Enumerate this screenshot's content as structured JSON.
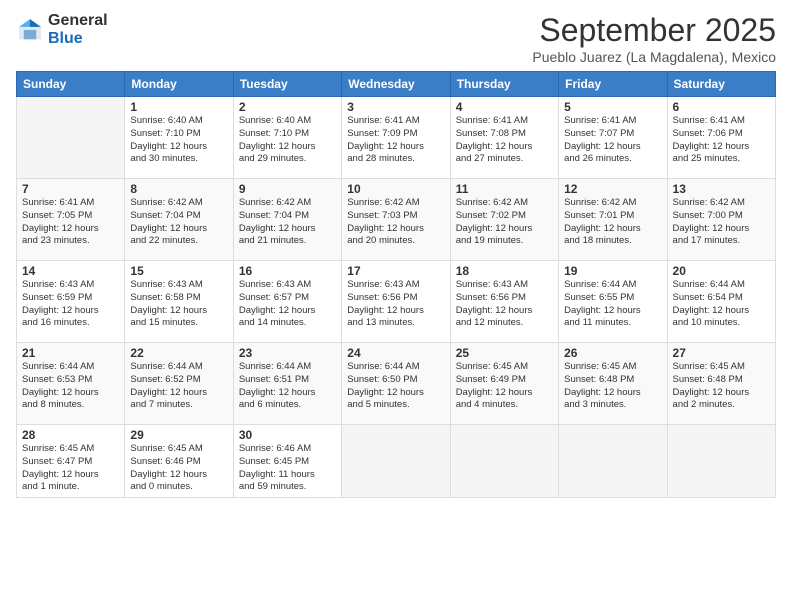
{
  "logo": {
    "general": "General",
    "blue": "Blue"
  },
  "header": {
    "month": "September 2025",
    "location": "Pueblo Juarez (La Magdalena), Mexico"
  },
  "days_of_week": [
    "Sunday",
    "Monday",
    "Tuesday",
    "Wednesday",
    "Thursday",
    "Friday",
    "Saturday"
  ],
  "weeks": [
    [
      {
        "num": "",
        "info": ""
      },
      {
        "num": "1",
        "info": "Sunrise: 6:40 AM\nSunset: 7:10 PM\nDaylight: 12 hours\nand 30 minutes."
      },
      {
        "num": "2",
        "info": "Sunrise: 6:40 AM\nSunset: 7:10 PM\nDaylight: 12 hours\nand 29 minutes."
      },
      {
        "num": "3",
        "info": "Sunrise: 6:41 AM\nSunset: 7:09 PM\nDaylight: 12 hours\nand 28 minutes."
      },
      {
        "num": "4",
        "info": "Sunrise: 6:41 AM\nSunset: 7:08 PM\nDaylight: 12 hours\nand 27 minutes."
      },
      {
        "num": "5",
        "info": "Sunrise: 6:41 AM\nSunset: 7:07 PM\nDaylight: 12 hours\nand 26 minutes."
      },
      {
        "num": "6",
        "info": "Sunrise: 6:41 AM\nSunset: 7:06 PM\nDaylight: 12 hours\nand 25 minutes."
      }
    ],
    [
      {
        "num": "7",
        "info": "Sunrise: 6:41 AM\nSunset: 7:05 PM\nDaylight: 12 hours\nand 23 minutes."
      },
      {
        "num": "8",
        "info": "Sunrise: 6:42 AM\nSunset: 7:04 PM\nDaylight: 12 hours\nand 22 minutes."
      },
      {
        "num": "9",
        "info": "Sunrise: 6:42 AM\nSunset: 7:04 PM\nDaylight: 12 hours\nand 21 minutes."
      },
      {
        "num": "10",
        "info": "Sunrise: 6:42 AM\nSunset: 7:03 PM\nDaylight: 12 hours\nand 20 minutes."
      },
      {
        "num": "11",
        "info": "Sunrise: 6:42 AM\nSunset: 7:02 PM\nDaylight: 12 hours\nand 19 minutes."
      },
      {
        "num": "12",
        "info": "Sunrise: 6:42 AM\nSunset: 7:01 PM\nDaylight: 12 hours\nand 18 minutes."
      },
      {
        "num": "13",
        "info": "Sunrise: 6:42 AM\nSunset: 7:00 PM\nDaylight: 12 hours\nand 17 minutes."
      }
    ],
    [
      {
        "num": "14",
        "info": "Sunrise: 6:43 AM\nSunset: 6:59 PM\nDaylight: 12 hours\nand 16 minutes."
      },
      {
        "num": "15",
        "info": "Sunrise: 6:43 AM\nSunset: 6:58 PM\nDaylight: 12 hours\nand 15 minutes."
      },
      {
        "num": "16",
        "info": "Sunrise: 6:43 AM\nSunset: 6:57 PM\nDaylight: 12 hours\nand 14 minutes."
      },
      {
        "num": "17",
        "info": "Sunrise: 6:43 AM\nSunset: 6:56 PM\nDaylight: 12 hours\nand 13 minutes."
      },
      {
        "num": "18",
        "info": "Sunrise: 6:43 AM\nSunset: 6:56 PM\nDaylight: 12 hours\nand 12 minutes."
      },
      {
        "num": "19",
        "info": "Sunrise: 6:44 AM\nSunset: 6:55 PM\nDaylight: 12 hours\nand 11 minutes."
      },
      {
        "num": "20",
        "info": "Sunrise: 6:44 AM\nSunset: 6:54 PM\nDaylight: 12 hours\nand 10 minutes."
      }
    ],
    [
      {
        "num": "21",
        "info": "Sunrise: 6:44 AM\nSunset: 6:53 PM\nDaylight: 12 hours\nand 8 minutes."
      },
      {
        "num": "22",
        "info": "Sunrise: 6:44 AM\nSunset: 6:52 PM\nDaylight: 12 hours\nand 7 minutes."
      },
      {
        "num": "23",
        "info": "Sunrise: 6:44 AM\nSunset: 6:51 PM\nDaylight: 12 hours\nand 6 minutes."
      },
      {
        "num": "24",
        "info": "Sunrise: 6:44 AM\nSunset: 6:50 PM\nDaylight: 12 hours\nand 5 minutes."
      },
      {
        "num": "25",
        "info": "Sunrise: 6:45 AM\nSunset: 6:49 PM\nDaylight: 12 hours\nand 4 minutes."
      },
      {
        "num": "26",
        "info": "Sunrise: 6:45 AM\nSunset: 6:48 PM\nDaylight: 12 hours\nand 3 minutes."
      },
      {
        "num": "27",
        "info": "Sunrise: 6:45 AM\nSunset: 6:48 PM\nDaylight: 12 hours\nand 2 minutes."
      }
    ],
    [
      {
        "num": "28",
        "info": "Sunrise: 6:45 AM\nSunset: 6:47 PM\nDaylight: 12 hours\nand 1 minute."
      },
      {
        "num": "29",
        "info": "Sunrise: 6:45 AM\nSunset: 6:46 PM\nDaylight: 12 hours\nand 0 minutes."
      },
      {
        "num": "30",
        "info": "Sunrise: 6:46 AM\nSunset: 6:45 PM\nDaylight: 11 hours\nand 59 minutes."
      },
      {
        "num": "",
        "info": ""
      },
      {
        "num": "",
        "info": ""
      },
      {
        "num": "",
        "info": ""
      },
      {
        "num": "",
        "info": ""
      }
    ]
  ]
}
